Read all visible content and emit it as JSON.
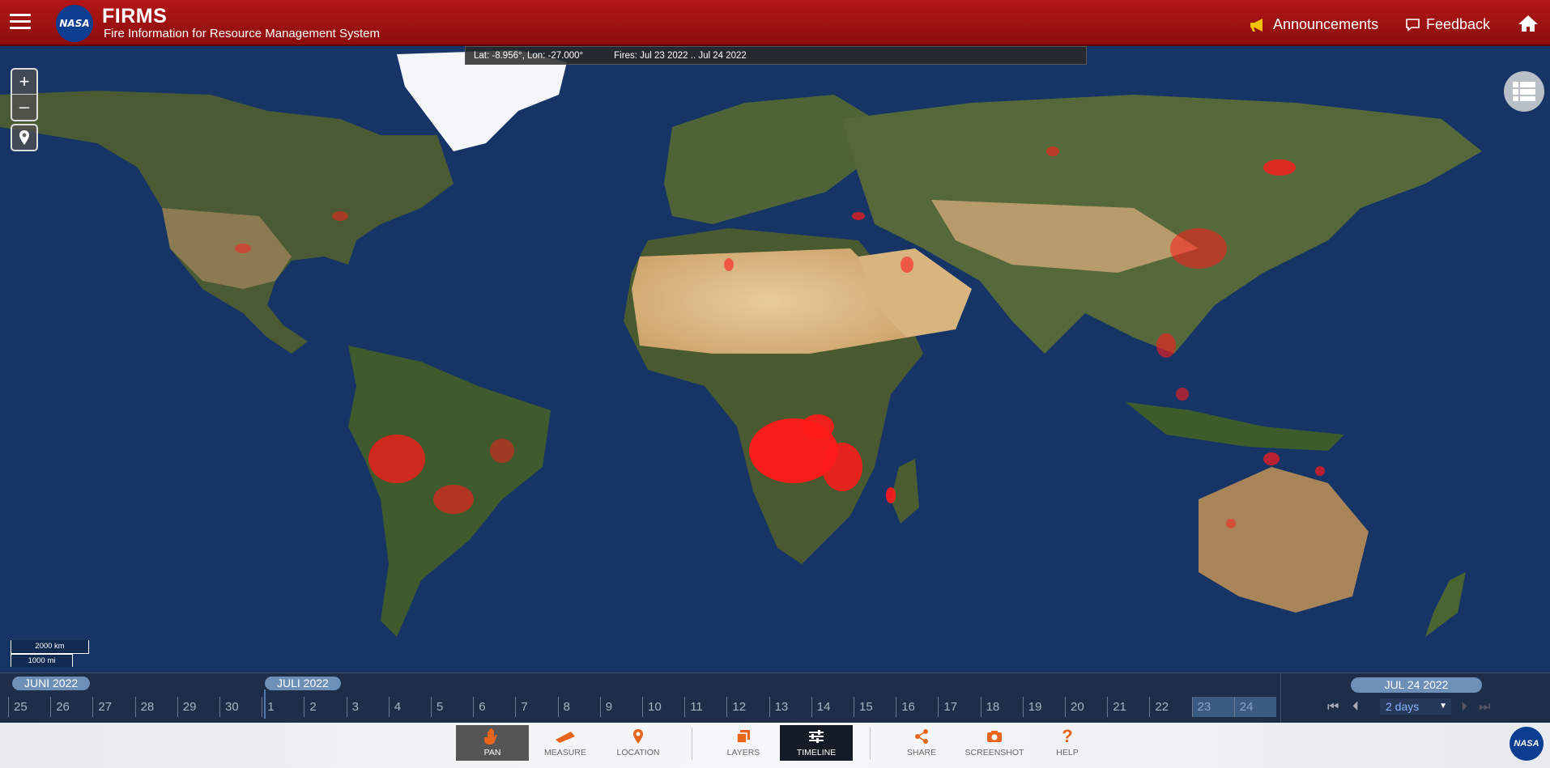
{
  "header": {
    "logo_text": "NASA",
    "title": "FIRMS",
    "subtitle": "Fire Information for Resource Management System",
    "announcements_label": "Announcements",
    "feedback_label": "Feedback"
  },
  "map": {
    "coordinates": "Lat: -8.956°, Lon: -27.000°",
    "fires_range": "Fires: Jul 23 2022 .. Jul 24 2022",
    "zoom_in": "+",
    "zoom_out": "–",
    "scale_km": "2000 km",
    "scale_mi": "1000 mi"
  },
  "timeline": {
    "months": [
      "JUNI 2022",
      "JULI 2022"
    ],
    "days": [
      "25",
      "26",
      "27",
      "28",
      "29",
      "30",
      "1",
      "2",
      "3",
      "4",
      "5",
      "6",
      "7",
      "8",
      "9",
      "10",
      "11",
      "12",
      "13",
      "14",
      "15",
      "16",
      "17",
      "18",
      "19",
      "20",
      "21",
      "22",
      "23",
      "24"
    ],
    "selected_days": [
      "23",
      "24"
    ],
    "current_date": "JUL 24 2022",
    "span_value": "2 days"
  },
  "toolbar": {
    "pan": "PAN",
    "measure": "MEASURE",
    "location": "LOCATION",
    "layers": "LAYERS",
    "timeline": "TIMELINE",
    "share": "SHARE",
    "screenshot": "SCREENSHOT",
    "help": "HELP"
  },
  "colors": {
    "header_red": "#b31717",
    "ocean": "#163566",
    "fire": "#ff1a1a",
    "timeline_bg": "#1e2e48",
    "accent_orange": "#e8651e"
  },
  "icons": [
    "hamburger-icon",
    "megaphone-icon",
    "chat-icon",
    "home-icon",
    "location-pin-icon",
    "layers-list-icon",
    "hand-icon",
    "ruler-icon",
    "map-pin-icon",
    "stack-icon",
    "sliders-icon",
    "share-icon",
    "camera-icon",
    "question-icon"
  ]
}
